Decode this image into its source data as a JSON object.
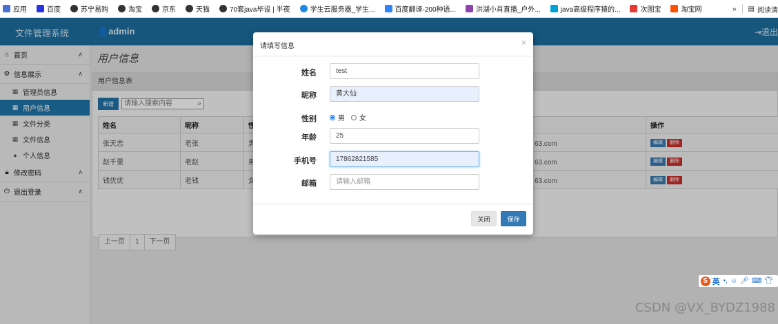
{
  "bookmarks": [
    {
      "label": "应用",
      "icon": "apps-icon",
      "color": "#4a6fd1"
    },
    {
      "label": "百度",
      "icon": "baidu-icon",
      "color": "#2932e1"
    },
    {
      "label": "苏宁易购",
      "icon": "globe-icon",
      "color": "#333333"
    },
    {
      "label": "淘宝",
      "icon": "globe-icon",
      "color": "#333333"
    },
    {
      "label": "京东",
      "icon": "globe-icon",
      "color": "#333333"
    },
    {
      "label": "天猫",
      "icon": "globe-icon",
      "color": "#333333"
    },
    {
      "label": "70套java毕设 | 半夜",
      "icon": "globe-icon",
      "color": "#333333"
    },
    {
      "label": "学生云服务器_学生...",
      "icon": "cloud-icon",
      "color": "#1e88e5"
    },
    {
      "label": "百度翻译-200种语...",
      "icon": "translate-icon",
      "color": "#3385ff"
    },
    {
      "label": "洪湖小肖直播_户外...",
      "icon": "stream-icon",
      "color": "#8e44ad"
    },
    {
      "label": "java高级程序猿的...",
      "icon": "bilibili-icon",
      "color": "#00a1d6"
    },
    {
      "label": "次图宝",
      "icon": "image-icon",
      "color": "#e53935"
    },
    {
      "label": "淘宝网",
      "icon": "taobao-icon",
      "color": "#ff5000"
    }
  ],
  "bookmarks_more": "»",
  "reading_list": "阅读清",
  "app": {
    "brand": "文件管理系统",
    "user": "admin",
    "logout_top": "退出"
  },
  "sidebar": {
    "groups": [
      {
        "label": "首页",
        "icon": "home-icon",
        "glyph": "🏠",
        "chevron": "︿"
      },
      {
        "label": "信息展示",
        "icon": "gear-icon",
        "glyph": "⚙",
        "chevron": "︿",
        "items": [
          {
            "label": "管理员信息",
            "glyph": "▦",
            "active": false
          },
          {
            "label": "用户信息",
            "glyph": "▦",
            "active": true
          },
          {
            "label": "文件分类",
            "glyph": "▦",
            "active": false
          },
          {
            "label": "文件信息",
            "glyph": "▦",
            "active": false
          },
          {
            "label": "个人信息",
            "glyph": "👤",
            "active": false
          }
        ]
      },
      {
        "label": "修改密码",
        "icon": "lock-icon",
        "glyph": "🔒",
        "chevron": "︿"
      },
      {
        "label": "退出登录",
        "icon": "power-icon",
        "glyph": "⏻",
        "chevron": "︿"
      }
    ]
  },
  "main": {
    "page_title": "用户信息",
    "panel_title": "用户信息表",
    "add_button": "新增",
    "search_placeholder": "请输入搜索内容",
    "columns": [
      "姓名",
      "昵称",
      "性",
      "操作"
    ],
    "rows": [
      {
        "name": "张天志",
        "nick": "老张",
        "gender": "男",
        "email": "63.com"
      },
      {
        "name": "赵千里",
        "nick": "老赵",
        "gender": "男",
        "email": "63.com"
      },
      {
        "name": "钱优优",
        "nick": "老钱",
        "gender": "女",
        "email": "63.com"
      }
    ],
    "edit_label": "编辑",
    "delete_label": "删除",
    "pager": {
      "prev": "上一页",
      "page": "1",
      "next": "下一页"
    }
  },
  "modal": {
    "title": "请填写信息",
    "close_glyph": "×",
    "fields": {
      "name_label": "姓名",
      "name_value": "test",
      "nick_label": "昵称",
      "nick_value": "黄大仙",
      "gender_label": "性别",
      "gender_male": "男",
      "gender_female": "女",
      "age_label": "年龄",
      "age_value": "25",
      "phone_label": "手机号",
      "phone_value": "17862821585",
      "email_label": "邮箱",
      "email_placeholder": "请输入邮箱"
    },
    "close_button": "关闭",
    "save_button": "保存"
  },
  "ime": {
    "logo": "S",
    "lang": "英"
  },
  "watermark": "CSDN @VX_BYDZ1988"
}
